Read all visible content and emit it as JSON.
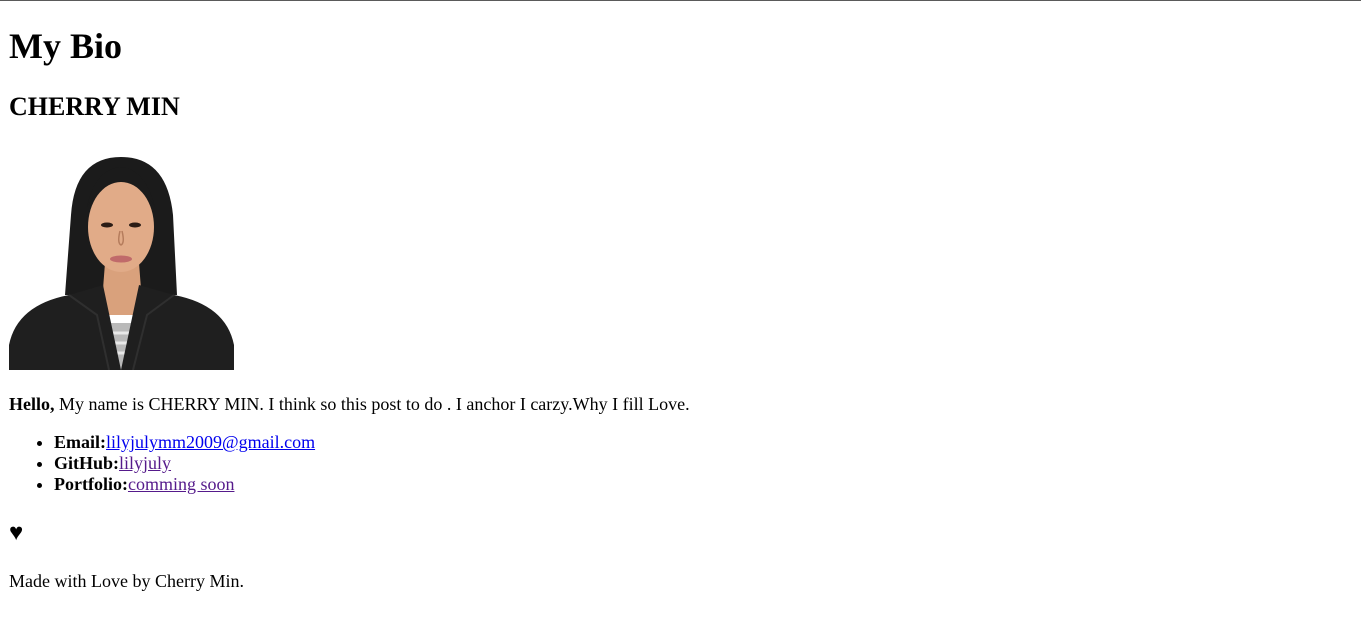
{
  "page": {
    "title": "My Bio",
    "name": "CHERRY MIN"
  },
  "intro": {
    "greeting": "Hello,",
    "text": " My name is CHERRY MIN. I think so this post to do . I anchor I carzy.Why I fill Love."
  },
  "contacts": [
    {
      "label": "Email:",
      "value": "lilyjulymm2009@gmail.com"
    },
    {
      "label": "GitHub:",
      "value": "lilyjuly"
    },
    {
      "label": "Portfolio:",
      "value": "comming soon"
    }
  ],
  "heart": "♥",
  "footer": "Made with Love by Cherry Min.",
  "colors": {
    "link": "#0000ee",
    "visited_link": "#551a8b",
    "text": "#000000",
    "background": "#ffffff"
  }
}
